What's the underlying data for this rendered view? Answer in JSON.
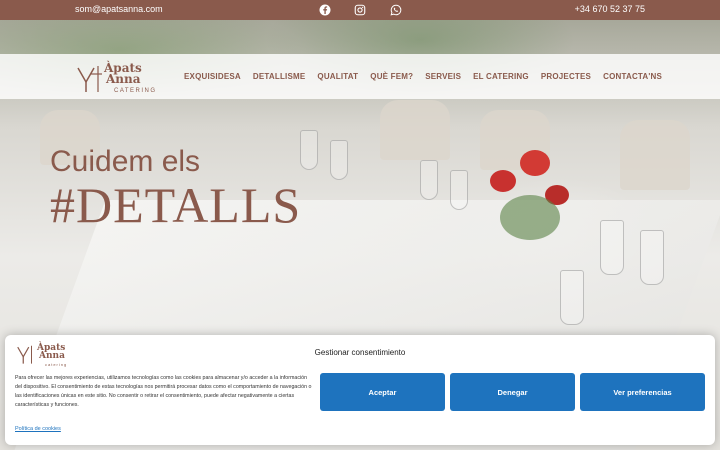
{
  "topbar": {
    "email": "som@apatsanna.com",
    "phone": "+34 670 52 37 75",
    "social": [
      "facebook-icon",
      "instagram-icon",
      "whatsapp-icon"
    ],
    "background": "#8a5a4c"
  },
  "logo": {
    "line1": "Àpats",
    "line2": "Anna",
    "sub": "CATERING"
  },
  "nav": {
    "items": [
      "EXQUISIDESA",
      "DETALLISME",
      "QUALITAT",
      "QUÈ FEM?",
      "SERVEIS",
      "EL CATERING",
      "PROJECTES",
      "CONTACTA'NS"
    ]
  },
  "hero": {
    "line1": "Cuidem els",
    "line2": "#DETALLS"
  },
  "cookie": {
    "logo": {
      "line1": "Àpats",
      "line2": "Anna",
      "sub": "catering"
    },
    "title": "Gestionar consentimiento",
    "text": "Para ofrecer las mejores experiencias, utilizamos tecnologías como las cookies para almacenar y/o acceder a la información del dispositivo. El consentimiento de estas tecnologías nos permitirá procesar datos como el comportamiento de navegación o las identificaciones únicas en este sitio. No consentir o retirar el consentimiento, puede afectar negativamente a ciertas características y funciones.",
    "policy_link": "Política de cookies",
    "accept": "Aceptar",
    "deny": "Denegar",
    "preferences": "Ver preferencias",
    "button_color": "#1e73be"
  },
  "colors": {
    "brand": "#8a5a4c",
    "accent": "#1e73be"
  }
}
